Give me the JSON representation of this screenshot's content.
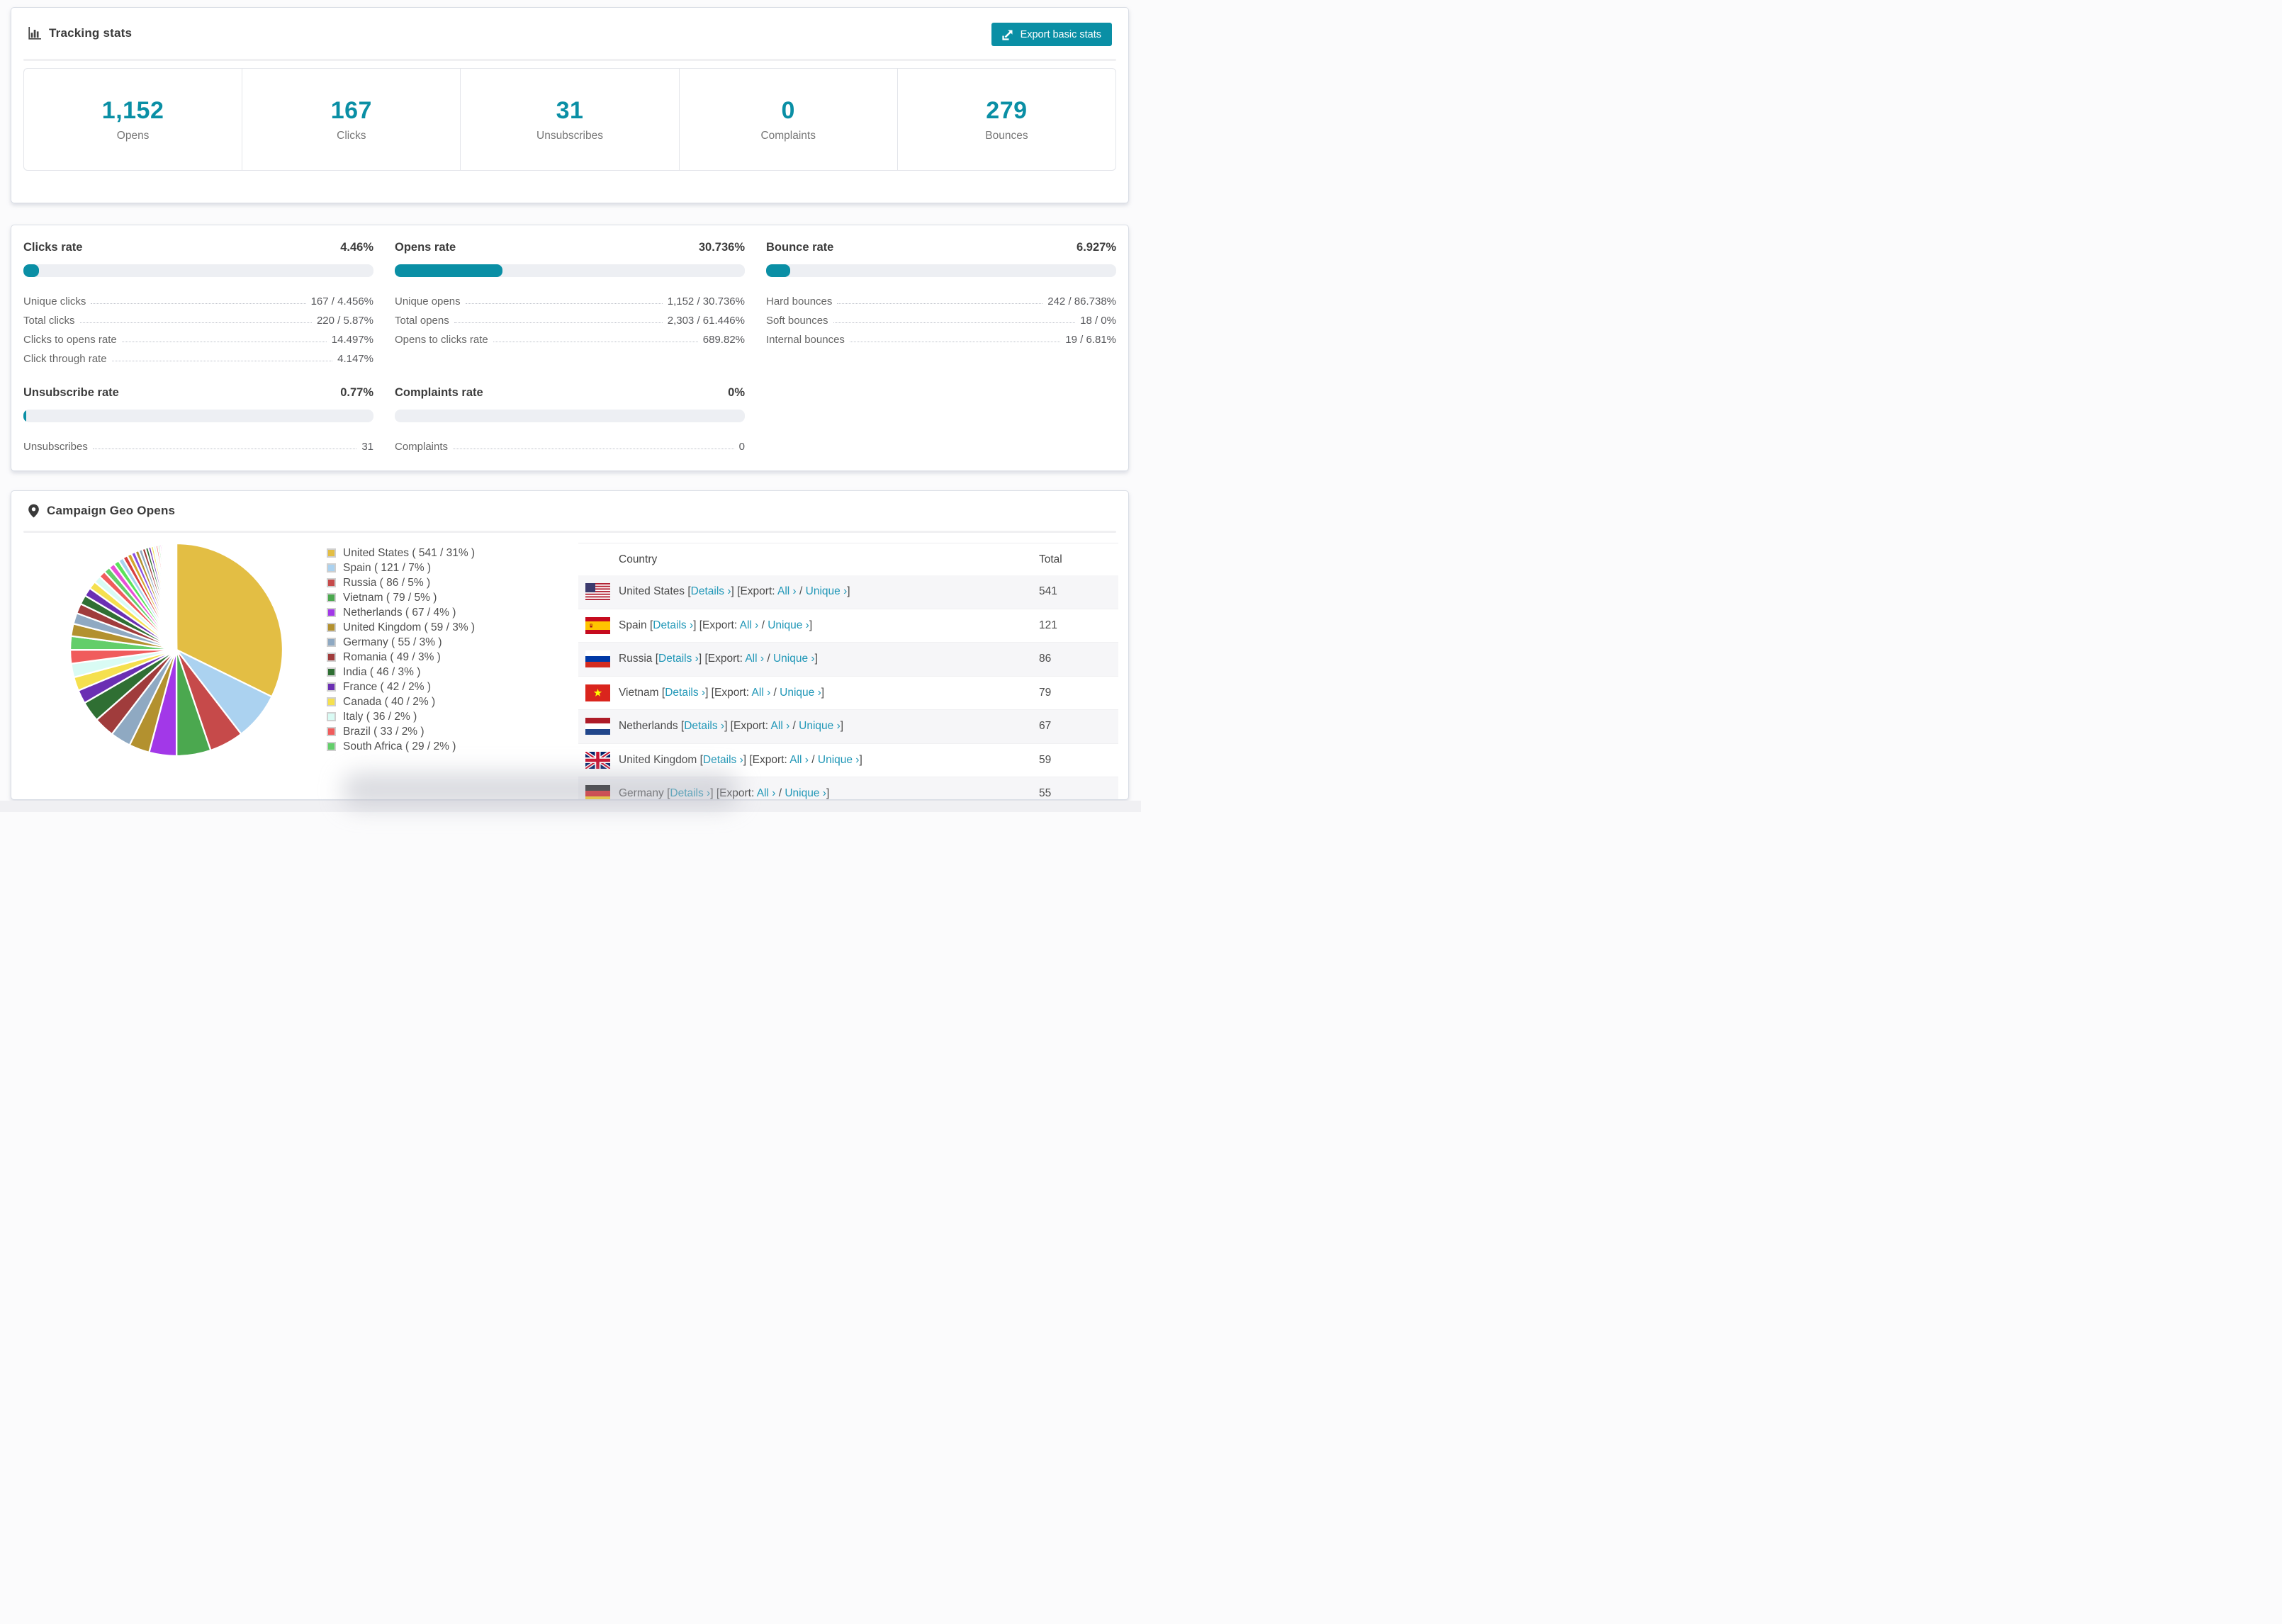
{
  "accent_color": "#0a8fa5",
  "link_color": "#2097b7",
  "tracking": {
    "title": "Tracking stats",
    "export_button": "Export basic stats",
    "summary": [
      {
        "value": "1,152",
        "label": "Opens"
      },
      {
        "value": "167",
        "label": "Clicks"
      },
      {
        "value": "31",
        "label": "Unsubscribes"
      },
      {
        "value": "0",
        "label": "Complaints"
      },
      {
        "value": "279",
        "label": "Bounces"
      }
    ]
  },
  "rates": {
    "blocks": [
      {
        "title": "Clicks rate",
        "value": "4.46%",
        "percent": 4.46,
        "rows": [
          {
            "label": "Unique clicks",
            "value": "167 / 4.456%"
          },
          {
            "label": "Total clicks",
            "value": "220 / 5.87%"
          },
          {
            "label": "Clicks to opens rate",
            "value": "14.497%"
          },
          {
            "label": "Click through rate",
            "value": "4.147%"
          }
        ]
      },
      {
        "title": "Opens rate",
        "value": "30.736%",
        "percent": 30.736,
        "rows": [
          {
            "label": "Unique opens",
            "value": "1,152 / 30.736%"
          },
          {
            "label": "Total opens",
            "value": "2,303 / 61.446%"
          },
          {
            "label": "Opens to clicks rate",
            "value": "689.82%"
          }
        ]
      },
      {
        "title": "Bounce rate",
        "value": "6.927%",
        "percent": 6.927,
        "rows": [
          {
            "label": "Hard bounces",
            "value": "242 / 86.738%"
          },
          {
            "label": "Soft bounces",
            "value": "18 / 0%"
          },
          {
            "label": "Internal bounces",
            "value": "19 / 6.81%"
          }
        ]
      },
      {
        "title": "Unsubscribe rate",
        "value": "0.77%",
        "percent": 0.77,
        "rows": [
          {
            "label": "Unsubscribes",
            "value": "31"
          }
        ]
      },
      {
        "title": "Complaints rate",
        "value": "0%",
        "percent": 0,
        "rows": [
          {
            "label": "Complaints",
            "value": "0"
          }
        ]
      }
    ]
  },
  "geo": {
    "title": "Campaign Geo Opens",
    "legend_format": "{label} ( {value} / {pct}% )",
    "table": {
      "columns": [
        "Country",
        "Total"
      ],
      "details_label": "Details ›",
      "export_prefix": "Export:",
      "all_label": "All ›",
      "unique_label": "Unique ›",
      "rows": [
        {
          "country": "United States",
          "flag": "us",
          "total": "541"
        },
        {
          "country": "Spain",
          "flag": "es",
          "total": "121"
        },
        {
          "country": "Russia",
          "flag": "ru",
          "total": "86"
        },
        {
          "country": "Vietnam",
          "flag": "vn",
          "total": "79"
        },
        {
          "country": "Netherlands",
          "flag": "nl",
          "total": "67"
        },
        {
          "country": "United Kingdom",
          "flag": "gb",
          "total": "59"
        },
        {
          "country": "Germany",
          "flag": "de",
          "total": "55"
        }
      ]
    }
  },
  "chart_data": {
    "type": "pie",
    "title": "Campaign Geo Opens",
    "legend_position": "right",
    "start_angle_deg": -90,
    "direction": "clockwise",
    "slices": [
      {
        "label": "United States",
        "value": 541,
        "pct": 31,
        "color": "#E3BE44"
      },
      {
        "label": "Spain",
        "value": 121,
        "pct": 7,
        "color": "#ABD2F0"
      },
      {
        "label": "Russia",
        "value": 86,
        "pct": 5,
        "color": "#C64A4A"
      },
      {
        "label": "Vietnam",
        "value": 79,
        "pct": 5,
        "color": "#4BA84F"
      },
      {
        "label": "Netherlands",
        "value": 67,
        "pct": 4,
        "color": "#A238E8"
      },
      {
        "label": "United Kingdom",
        "value": 59,
        "pct": 3,
        "color": "#B3912F"
      },
      {
        "label": "Germany",
        "value": 55,
        "pct": 3,
        "color": "#8FA9C2"
      },
      {
        "label": "Romania",
        "value": 49,
        "pct": 3,
        "color": "#A03C3C"
      },
      {
        "label": "India",
        "value": 46,
        "pct": 3,
        "color": "#2F6F33"
      },
      {
        "label": "France",
        "value": 42,
        "pct": 2,
        "color": "#6B2FB3"
      },
      {
        "label": "Canada",
        "value": 40,
        "pct": 2,
        "color": "#F5E04E"
      },
      {
        "label": "Italy",
        "value": 36,
        "pct": 2,
        "color": "#D9FBF4"
      },
      {
        "label": "Brazil",
        "value": 33,
        "pct": 2,
        "color": "#F05C5C"
      },
      {
        "label": "South Africa",
        "value": 29,
        "pct": 2,
        "color": "#63CE6A"
      }
    ],
    "others_small_slices": {
      "note": "remaining countries, progressively thinner slivers",
      "values": [
        1.8,
        1.6,
        1.45,
        1.35,
        1.25,
        1.15,
        1.05,
        0.98,
        0.92,
        0.86,
        0.8,
        0.75,
        0.7,
        0.65,
        0.6,
        0.56,
        0.52,
        0.48,
        0.44,
        0.4,
        0.37,
        0.34,
        0.31,
        0.28,
        0.26,
        0.24,
        0.22,
        0.2,
        0.18,
        0.16,
        0.14,
        0.13,
        0.12,
        0.11,
        0.1,
        0.09,
        0.08,
        0.07,
        0.06,
        0.055,
        0.05,
        0.045,
        0.04,
        0.035,
        0.03
      ],
      "colors_cycle": [
        "#B3912F",
        "#8FA9C2",
        "#A03C3C",
        "#2F6F33",
        "#6B2FB3",
        "#F5E04E",
        "#D9FBF4",
        "#F05C5C",
        "#63CE6A",
        "#E84FD7",
        "#5BE35B",
        "#A8D4F0",
        "#D84040",
        "#D4A72C",
        "#8A4FE3"
      ]
    }
  }
}
